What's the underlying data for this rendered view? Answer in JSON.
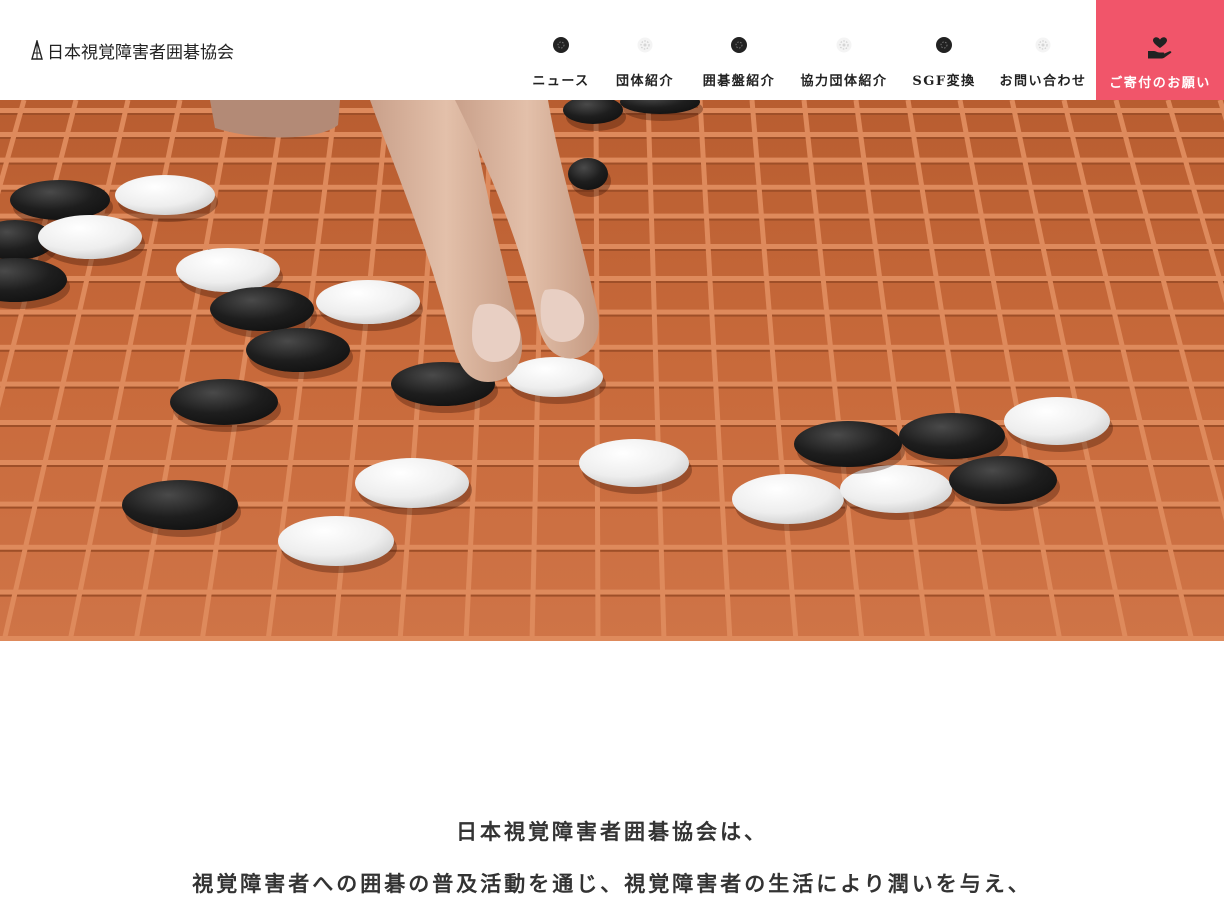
{
  "header": {
    "logo_text": "日本視覚障害者囲碁協会",
    "nav": [
      {
        "label": "ニュース",
        "stone": "black"
      },
      {
        "label": "団体紹介",
        "stone": "white"
      },
      {
        "label": "囲碁盤紹介",
        "stone": "black"
      },
      {
        "label": "協力団体紹介",
        "stone": "white"
      },
      {
        "label": "SGF変換",
        "stone": "black"
      },
      {
        "label": "お問い合わせ",
        "stone": "white"
      }
    ],
    "donate": {
      "label": "ご寄付のお願い",
      "icon": "heart-hand-icon",
      "color": "#f1556a"
    }
  },
  "hero": {
    "image": "go-board-photo",
    "board_color": "#c9693a"
  },
  "intro": {
    "lines": [
      "日本視覚障害者囲碁協会は、",
      "視覚障害者への囲碁の普及活動を通じ、視覚障害者の生活により潤いを与え、"
    ]
  }
}
